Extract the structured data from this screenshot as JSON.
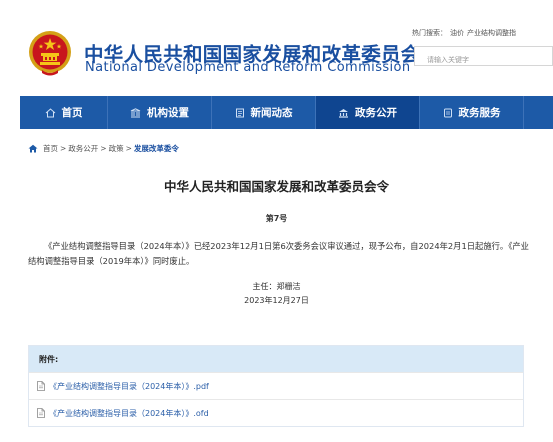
{
  "header": {
    "title_cn": "中华人民共和国国家发展和改革委员会",
    "title_en": "National Development and Reform Commission",
    "hot_search_label": "热门搜索：",
    "hot_search_terms": [
      "油价",
      "产业结构调整指"
    ],
    "search_placeholder": "请输入关键字"
  },
  "nav": {
    "items": [
      {
        "label": "首页",
        "icon": "home-icon"
      },
      {
        "label": "机构设置",
        "icon": "building-icon"
      },
      {
        "label": "新闻动态",
        "icon": "news-icon"
      },
      {
        "label": "政务公开",
        "icon": "government-icon",
        "active": true
      },
      {
        "label": "政务服务",
        "icon": "service-icon"
      }
    ]
  },
  "breadcrumb": {
    "items": [
      "首页",
      "政务公开",
      "政策",
      "发展改革委令"
    ],
    "separator": ">"
  },
  "article": {
    "title": "中华人民共和国国家发展和改革委员会令",
    "order_no": "第7号",
    "body": "《产业结构调整指导目录（2024年本）》已经2023年12月1日第6次委务会议审议通过，现予公布，自2024年2月1日起施行。《产业结构调整指导目录（2019年本）》同时废止。",
    "signer": "主任：郑栅洁",
    "date": "2023年12月27日"
  },
  "attachments": {
    "heading": "附件:",
    "files": [
      "《产业结构调整指导目录（2024年本）》.pdf",
      "《产业结构调整指导目录（2024年本）》.ofd"
    ]
  },
  "colors": {
    "brand_blue": "#1d5aa7",
    "nav_active": "#0f4590",
    "title_blue": "#1a4fa0",
    "attach_header_bg": "#d8e9f7"
  }
}
